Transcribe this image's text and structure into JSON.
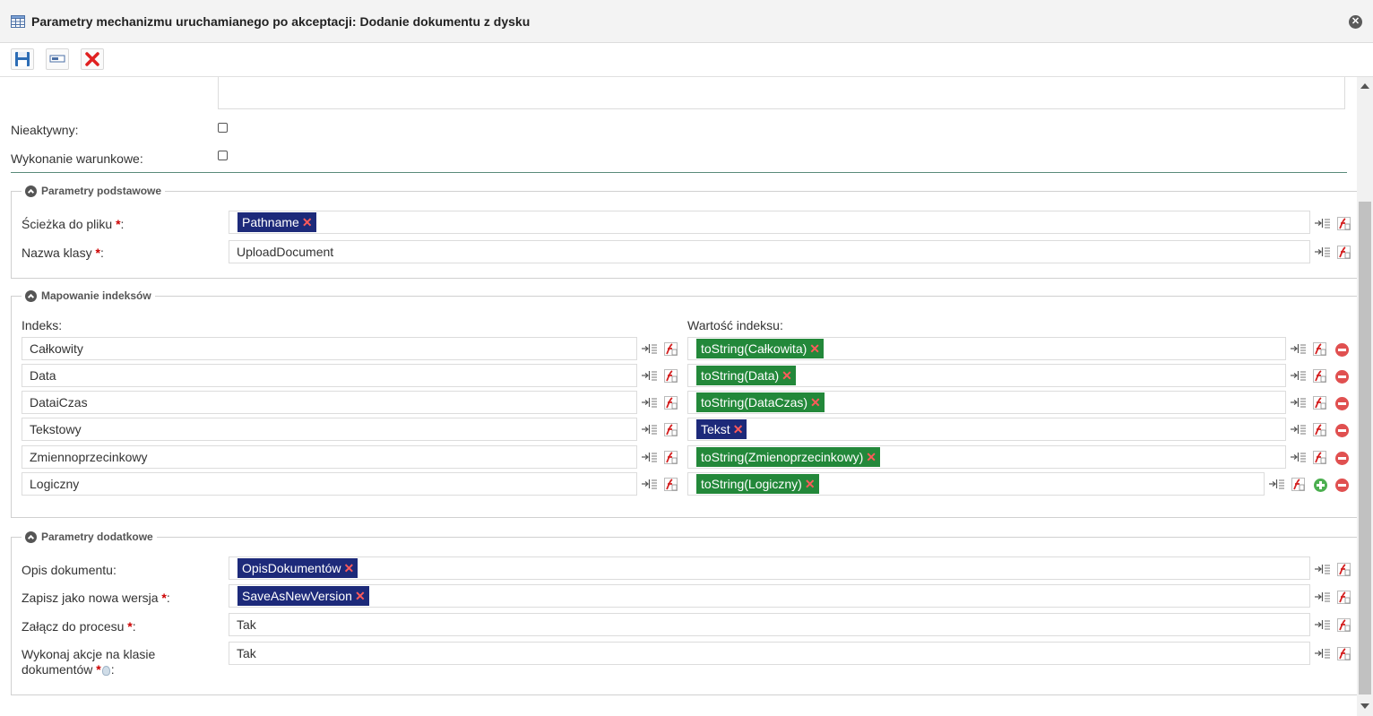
{
  "window": {
    "title": "Parametry mechanizmu uruchamianego po akceptacji: Dodanie dokumentu z dysku",
    "icon": "table-icon",
    "close_icon": "close-icon"
  },
  "toolbar": {
    "buttons": [
      {
        "name": "save-button",
        "icon": "floppy-disk-icon"
      },
      {
        "name": "window-button",
        "icon": "window-icon"
      },
      {
        "name": "cancel-button",
        "icon": "red-x-icon"
      }
    ]
  },
  "general": {
    "inactive_label": "Nieaktywny:",
    "conditional_label": "Wykonanie warunkowe:"
  },
  "basic": {
    "legend": "Parametry podstawowe",
    "path_label": "Ścieżka do pliku",
    "path_value": "Pathname",
    "class_label": "Nazwa klasy",
    "class_value": "UploadDocument"
  },
  "mapping": {
    "legend": "Mapowanie indeksów",
    "index_header": "Indeks:",
    "value_header": "Wartość indeksu:",
    "rows": [
      {
        "index": "Całkowity",
        "value": "toString(Całkowita)",
        "color": "green"
      },
      {
        "index": "Data",
        "value": "toString(Data)",
        "color": "green"
      },
      {
        "index": "DataiCzas",
        "value": "toString(DataCzas)",
        "color": "green"
      },
      {
        "index": "Tekstowy",
        "value": "Tekst",
        "color": "blue"
      },
      {
        "index": "Zmiennoprzecinkowy",
        "value": "toString(Zmienoprzecinkowy)",
        "color": "green"
      },
      {
        "index": "Logiczny",
        "value": "toString(Logiczny)",
        "color": "green"
      }
    ]
  },
  "extra": {
    "legend": "Parametry dodatkowe",
    "description_label": "Opis dokumentu:",
    "description_value": "OpisDokumentów",
    "new_version_label": "Zapisz jako nowa wersja",
    "new_version_value": "SaveAsNewVersion",
    "attach_label": "Załącz do procesu",
    "attach_value": "Tak",
    "action_label_line1": "Wykonaj akcje na klasie",
    "action_label_line2": "dokumentów",
    "action_value": "Tak"
  },
  "symbols": {
    "required": "*",
    "colon": ":",
    "remove": "✕",
    "map_arrow": "⇥"
  },
  "colors": {
    "tag_blue": "#1d2a7a",
    "tag_green": "#23883a",
    "required_red": "#cc0000"
  }
}
